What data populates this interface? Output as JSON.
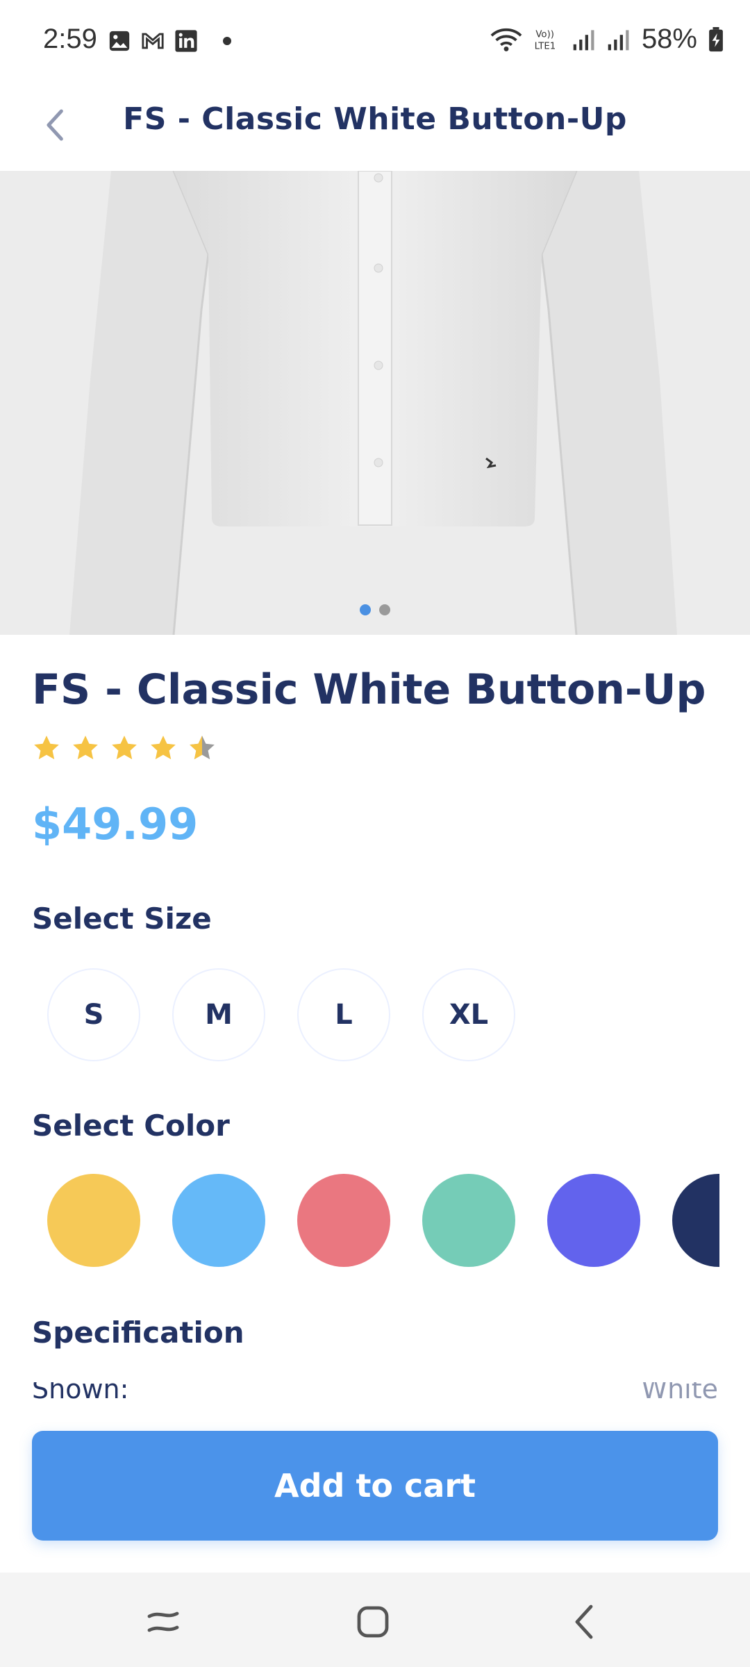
{
  "status_bar": {
    "time": "2:59",
    "battery_percent": "58%",
    "notification_icons": [
      "image-icon",
      "gmail-icon",
      "linkedin-icon",
      "dot-icon"
    ],
    "system_icons": [
      "wifi-icon",
      "volte-icon",
      "signal-icon",
      "signal-icon",
      "battery-charging-icon"
    ]
  },
  "header": {
    "title": "FS - Classic White Button-Up",
    "back_icon": "chevron-left-icon"
  },
  "gallery": {
    "image_description": "white button-up shirt",
    "page_count": 2,
    "active_page": 1
  },
  "product": {
    "title": "FS - Classic White Button-Up",
    "rating": 4.5,
    "rating_max": 5,
    "price": "$49.99"
  },
  "size_section": {
    "title": "Select Size",
    "options": [
      "S",
      "M",
      "L",
      "XL"
    ]
  },
  "color_section": {
    "title": "Select Color",
    "options": [
      "#f6c957",
      "#65b9f8",
      "#ea7780",
      "#75ccb7",
      "#6263ed",
      "#223263"
    ]
  },
  "spec_section": {
    "title": "Specification",
    "rows": [
      {
        "label": "Shown:",
        "value": "White"
      }
    ]
  },
  "cart": {
    "label": "Add to cart"
  },
  "colors": {
    "primary": "#4b93ea",
    "price": "#60b4f6",
    "text_dark": "#223263",
    "star": "#f6c343"
  },
  "nav_bar": {
    "icons": [
      "recents-icon",
      "home-icon",
      "back-icon"
    ]
  }
}
